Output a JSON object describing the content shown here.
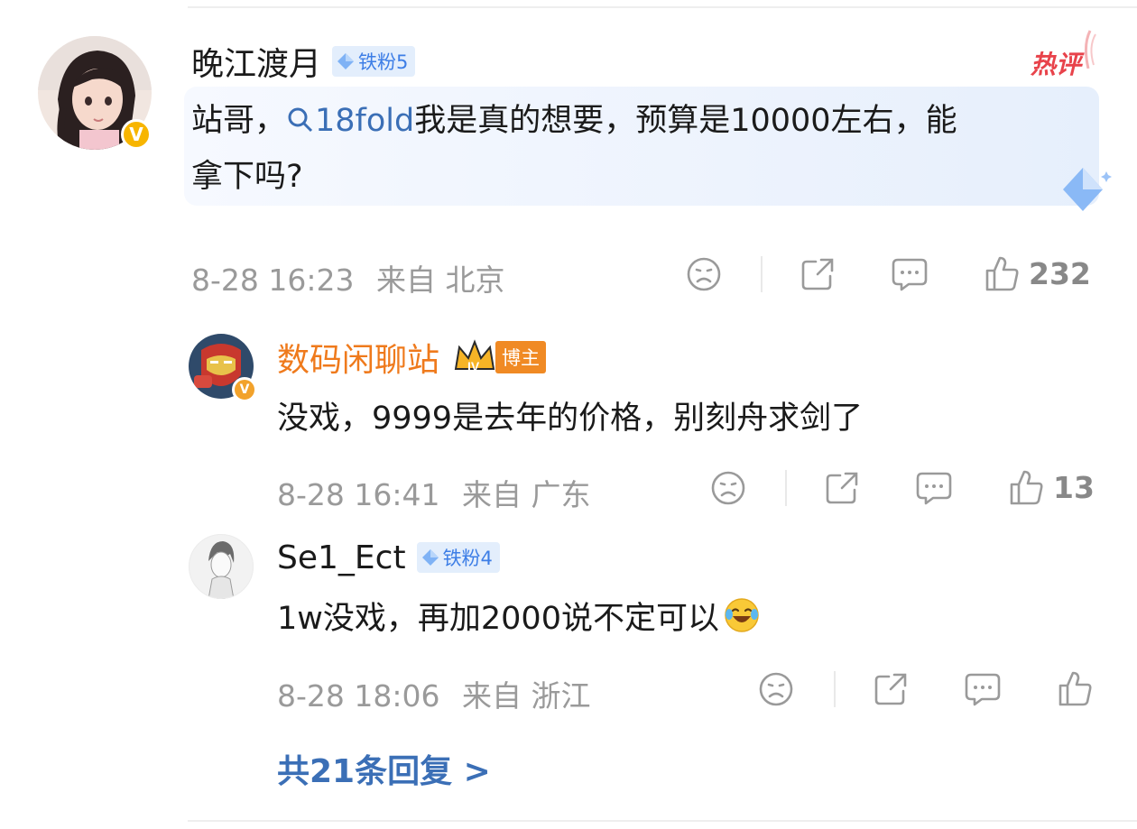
{
  "comments": [
    {
      "username": "晚江渡月",
      "badge": "铁粉5",
      "hot_label": "热评",
      "text_pre": "站哥，",
      "keyword": "18fold",
      "text_post": "我是真的想要，预算是10000左右，能",
      "text_line2": "拿下吗?",
      "date": "8-28 16:23",
      "from": "来自 北京",
      "likes": "232"
    },
    {
      "username": "数码闲聊站",
      "role_badge": "博主",
      "role_level": "IV",
      "text": "没戏，9999是去年的价格，别刻舟求剑了",
      "date": "8-28 16:41",
      "from": "来自 广东",
      "likes": "13"
    },
    {
      "username": "Se1_Ect",
      "badge": "铁粉4",
      "text": "1w没戏，再加2000说不定可以",
      "date": "8-28 18:06",
      "from": "来自 浙江",
      "likes": ""
    }
  ],
  "replies_link": "共21条回复 >",
  "colors": {
    "link": "#3b6fb6",
    "username_blogger": "#ef7a1c",
    "badge_bg": "#e3eefc",
    "meta": "#9a9a9a",
    "hot": "#e8434b"
  }
}
